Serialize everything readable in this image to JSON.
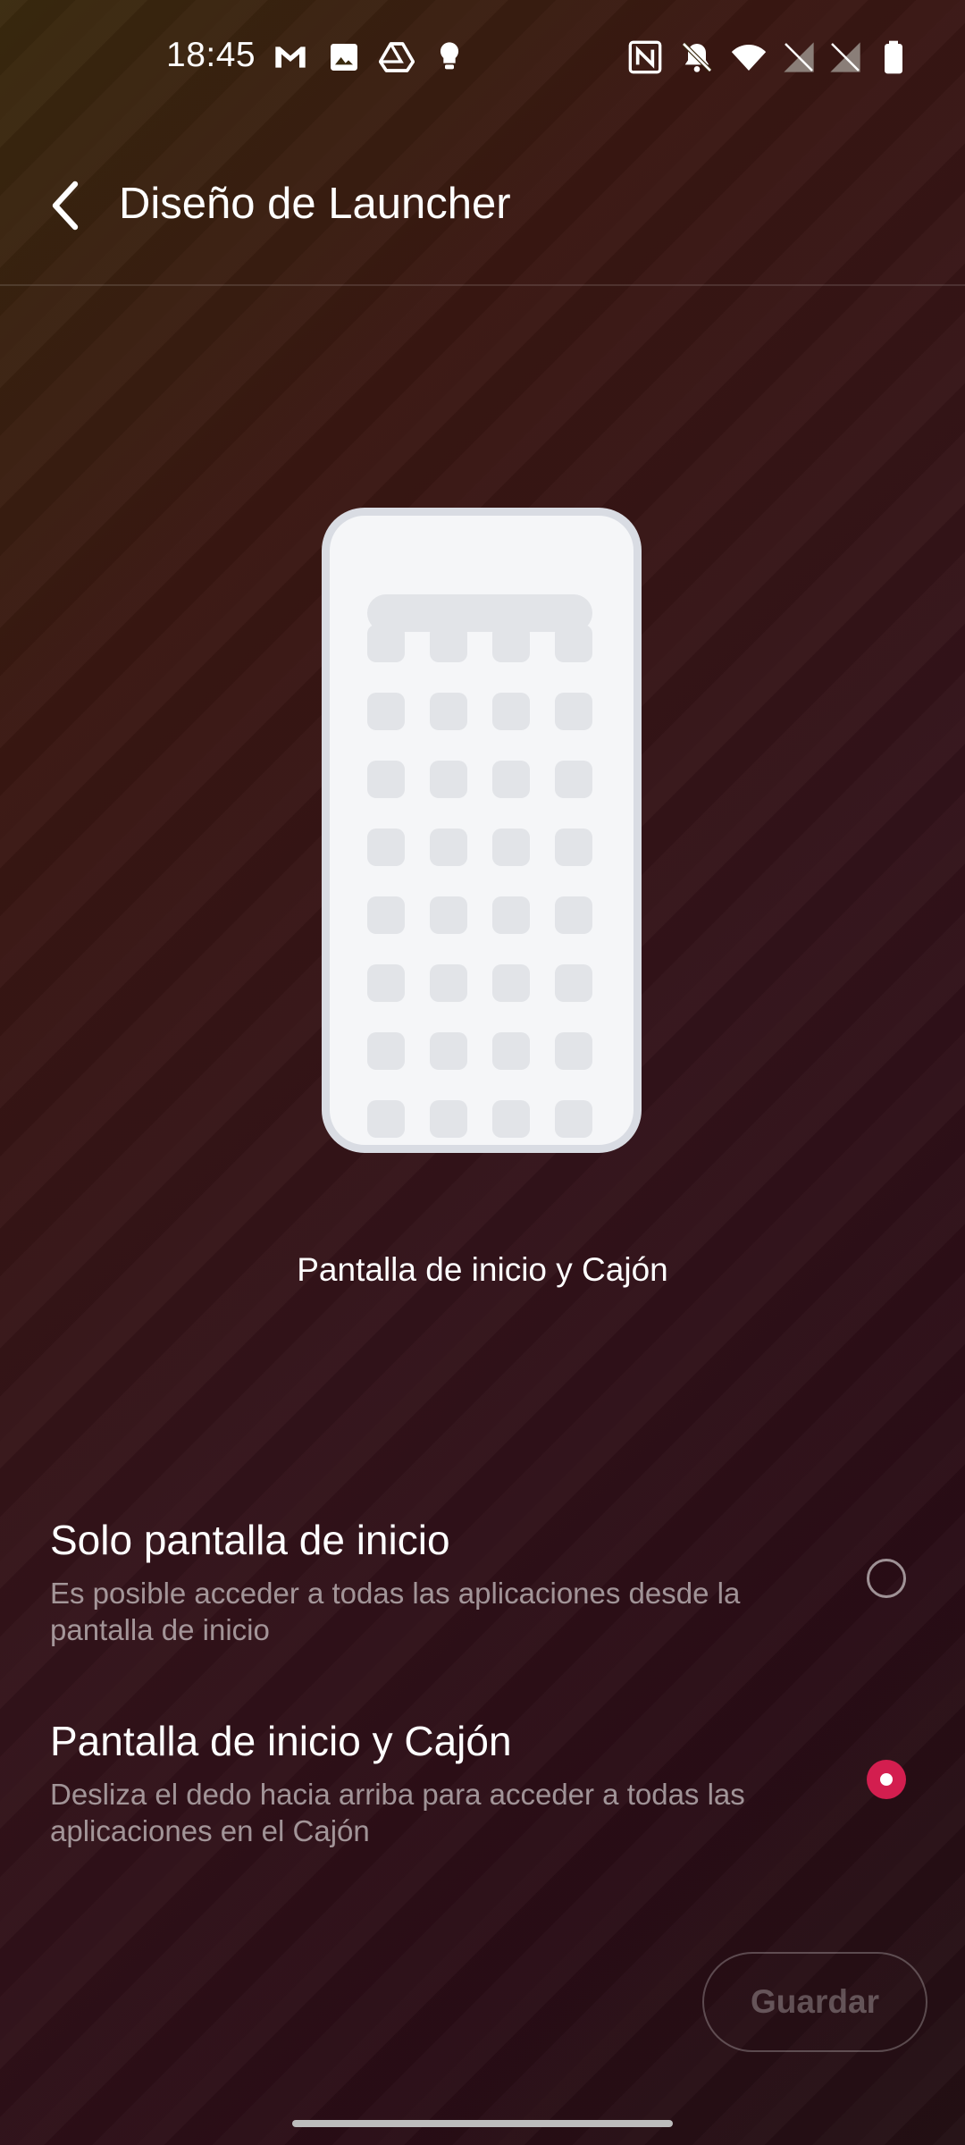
{
  "status_bar": {
    "time": "18:45",
    "left_icons": [
      "gmail-icon",
      "gallery-icon",
      "drive-icon",
      "bulb-icon"
    ],
    "right_icons": [
      "nfc-icon",
      "bell-off-icon",
      "wifi-icon",
      "no-sim-icon",
      "no-sim-icon",
      "battery-icon"
    ]
  },
  "header": {
    "title": "Diseño de Launcher"
  },
  "preview": {
    "caption": "Pantalla de inicio y Cajón"
  },
  "options": [
    {
      "title": "Solo pantalla de inicio",
      "description": "Es posible acceder a todas las aplicaciones desde la pantalla de inicio",
      "selected": false
    },
    {
      "title": "Pantalla de inicio y Cajón",
      "description": "Desliza el dedo hacia arriba para acceder a todas las aplicaciones en el Cajón",
      "selected": true
    }
  ],
  "actions": {
    "save_label": "Guardar"
  },
  "colors": {
    "accent": "#d31e4f"
  }
}
